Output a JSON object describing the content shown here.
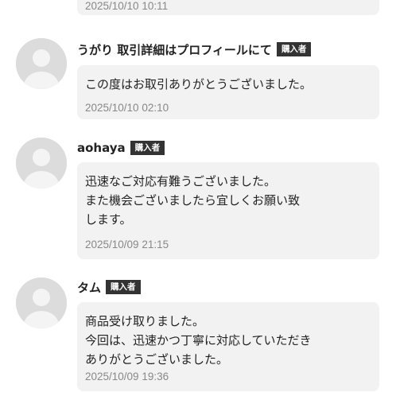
{
  "reviews": [
    {
      "timestamp": "2025/10/10 10:11"
    },
    {
      "name": "うがり 取引詳細はプロフィールにて",
      "badge": "購入者",
      "lines": [
        "この度はお取引ありがとうございました。"
      ],
      "timestamp": "2025/10/10 02:10"
    },
    {
      "name": "aohaya",
      "badge": "購入者",
      "lines": [
        "迅速なご対応有難うございました。",
        "また機会ございましたら宜しくお願い致",
        "します。"
      ],
      "timestamp": "2025/10/09 21:15"
    },
    {
      "name": "タム",
      "badge": "購入者",
      "lines": [
        "商品受け取りました。",
        "今回は、迅速かつ丁寧に対応していただき",
        "ありがとうございました。"
      ],
      "timestamp": "2025/10/09 19:36"
    }
  ],
  "icons": {
    "avatar": "default-user-avatar-icon"
  },
  "colors": {
    "bubble_bg": "#f2f2f2",
    "badge_bg": "#333333",
    "timestamp": "#888888",
    "avatar_bg": "#dcdcdc"
  }
}
